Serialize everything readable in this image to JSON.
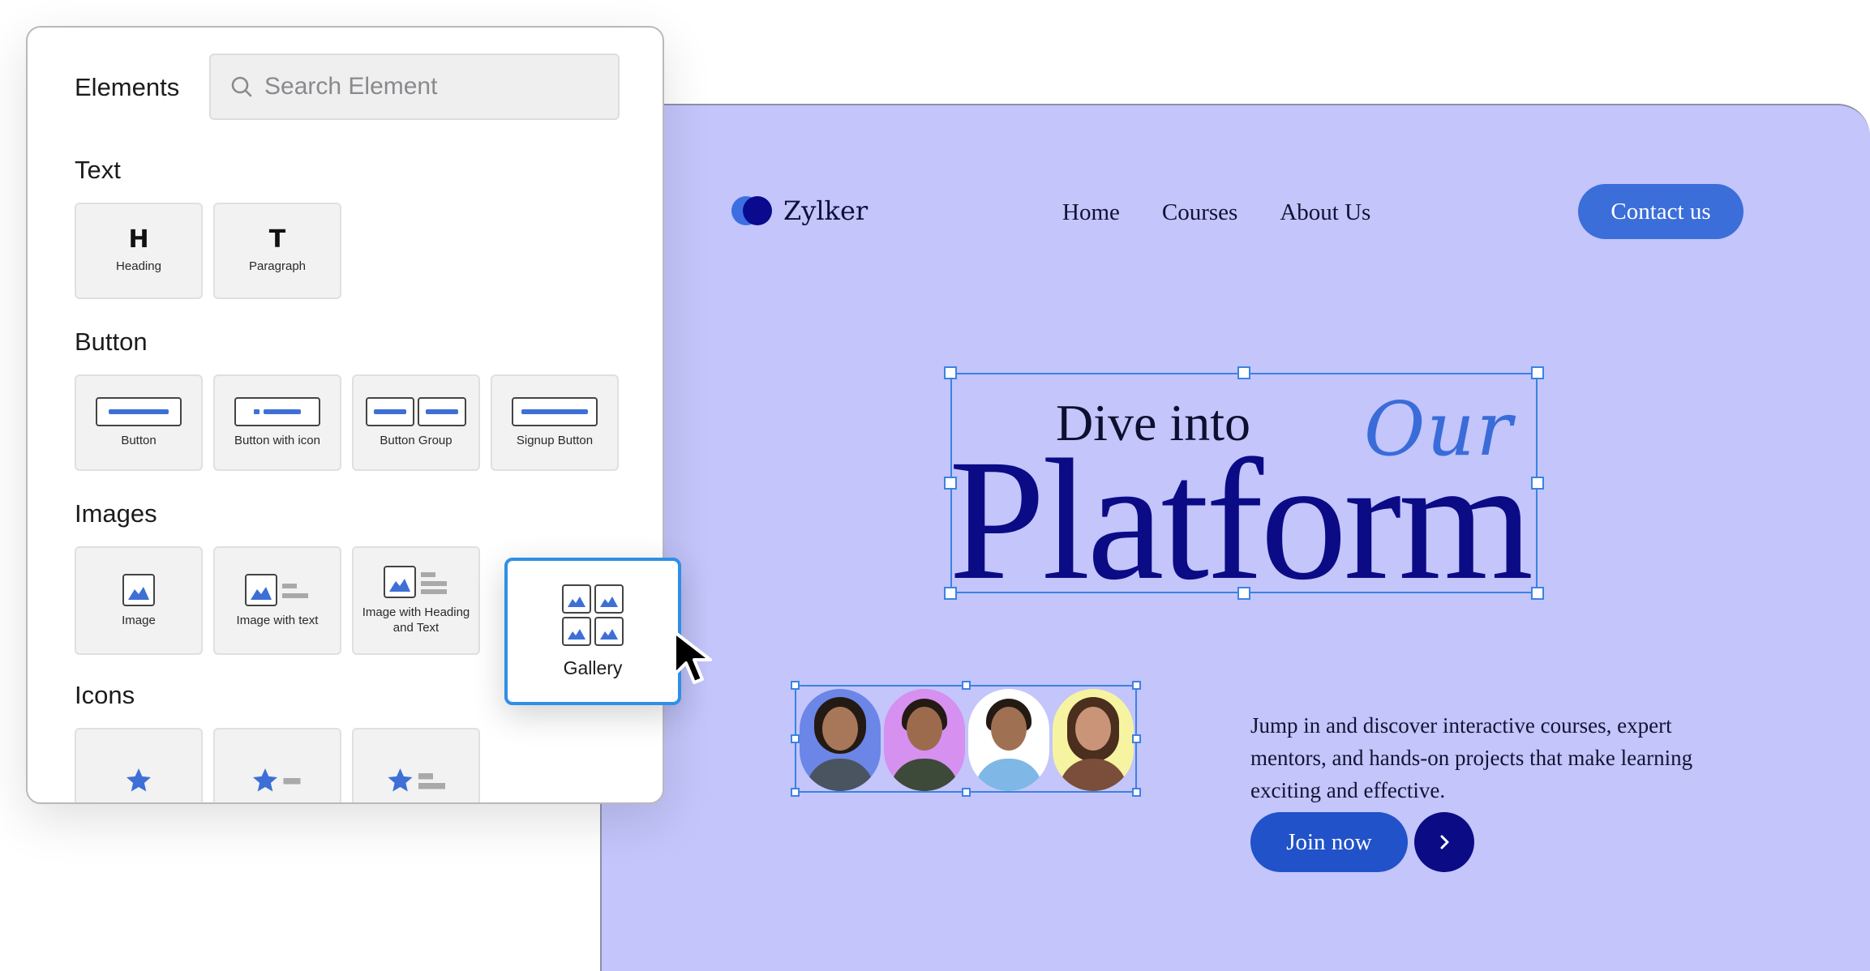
{
  "panel": {
    "title": "Elements",
    "search_placeholder": "Search Element",
    "sections": {
      "text": "Text",
      "button": "Button",
      "images": "Images",
      "icons": "Icons"
    },
    "text_items": [
      {
        "glyph": "H",
        "label": "Heading"
      },
      {
        "glyph": "T",
        "label": "Paragraph"
      }
    ],
    "button_items": [
      "Button",
      "Button with icon",
      "Button Group",
      "Signup Button"
    ],
    "image_items": [
      "Image",
      "Image with text",
      "Image with Heading and Text"
    ],
    "dragged_item": "Gallery"
  },
  "site": {
    "logo": "Zylker",
    "nav": [
      "Home",
      "Courses",
      "About Us"
    ],
    "contact_button": "Contact us",
    "headline_top": "Dive into",
    "headline_script": "Our",
    "headline_main": "Platform",
    "description": "Jump in and discover interactive courses, expert mentors, and hands-on projects that make learning exciting and effective.",
    "join_button": "Join now"
  },
  "colors": {
    "site_bg": "#c3c5fb",
    "accent": "#3b6ed9",
    "navy": "#0c0b86",
    "selection": "#3c82e2",
    "icon_blue": "#3d6fd6"
  }
}
